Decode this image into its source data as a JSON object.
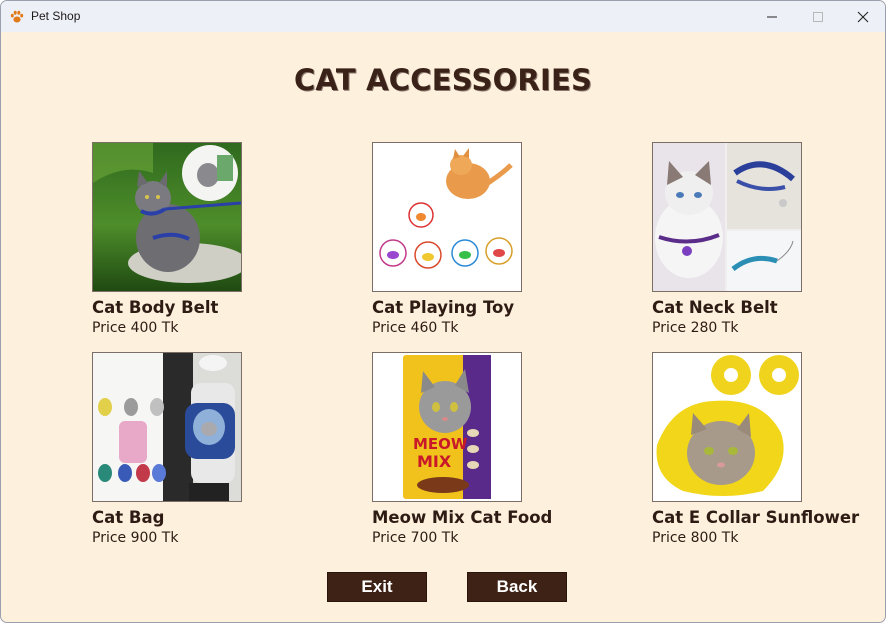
{
  "window": {
    "title": "Pet Shop",
    "app_icon": "paw-icon",
    "controls": [
      "minimize-icon",
      "maximize-icon",
      "close-icon"
    ]
  },
  "page": {
    "heading": "CAT ACCESSORIES"
  },
  "products": [
    {
      "name": "Cat Body Belt",
      "price": "Price 400 Tk",
      "image": "cat-body-belt-photo"
    },
    {
      "name": "Cat Playing Toy",
      "price": "Price 460 Tk",
      "image": "cat-playing-toy-photo"
    },
    {
      "name": "Cat Neck Belt",
      "price": "Price 280 Tk",
      "image": "cat-neck-belt-photo"
    },
    {
      "name": "Cat Bag",
      "price": "Price 900 Tk",
      "image": "cat-bag-photo"
    },
    {
      "name": "Meow Mix Cat Food",
      "price": "Price 700 Tk",
      "image": "meow-mix-cat-food-photo",
      "brand_text": "MEOW MIX"
    },
    {
      "name": "Cat E Collar Sunflower",
      "price": "Price 800 Tk",
      "image": "cat-e-collar-photo"
    }
  ],
  "buttons": {
    "exit": "Exit",
    "back": "Back"
  },
  "colors": {
    "background": "#fdf0dd",
    "heading": "#3a2218",
    "button_bg": "#3e2216",
    "button_text": "#ffffff",
    "titlebar": "#eef0f7"
  }
}
